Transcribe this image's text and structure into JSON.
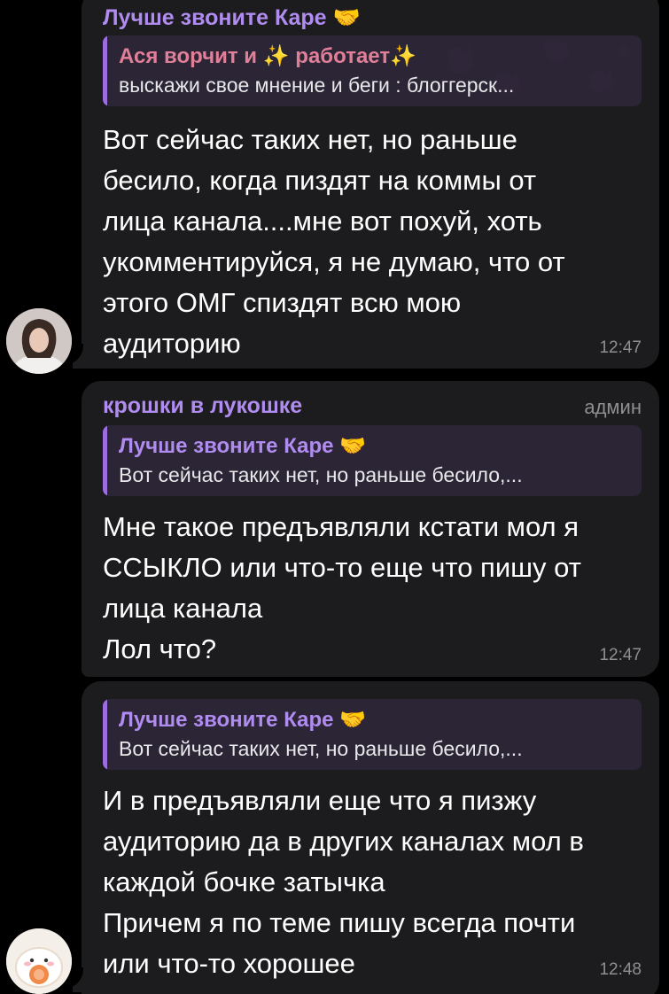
{
  "messages": [
    {
      "author": "Лучше звоните Каре",
      "author_emoji": "🤝",
      "reply": {
        "title_part1": "Ася ворчит и",
        "title_part2": "работает",
        "sparkle": "✨",
        "text": "выскажи свое мнение и беги : блоггерск..."
      },
      "text": "Вот сейчас таких нет, но раньше\nбесило, когда пиздят на коммы от\nлица канала....мне вот похуй, хоть\nукомментируйся, я не думаю, что от\nэтого ОМГ спиздят всю мою\nаудиторию",
      "time": "12:47"
    },
    {
      "author": "крошки в лукошке",
      "role": "админ",
      "reply": {
        "title": "Лучше звоните Каре",
        "title_emoji": "🤝",
        "text": "Вот сейчас таких нет, но раньше бесило,..."
      },
      "text": "Мне такое предъявляли кстати мол я\nССЫКЛО или что-то еще что пишу от\nлица канала\nЛол что?",
      "time": "12:47"
    },
    {
      "reply": {
        "title": "Лучше звоните Каре",
        "title_emoji": "🤝",
        "text": "Вот сейчас таких нет, но раньше бесило,..."
      },
      "text": "И в предъявляли еще что я пизжу\nаудиторию да в других каналах мол в\nкаждой бочке затычка\nПричем я по теме пишу всегда почти\nили что-то хорошее",
      "time": "12:48"
    }
  ],
  "colors": {
    "background": "#000000",
    "bubble": "#1c1c1e",
    "author": "#b18cf0",
    "quote_bg": "#2b2536",
    "quote_bar": "#9b6de0",
    "muted": "#8e8e93"
  }
}
